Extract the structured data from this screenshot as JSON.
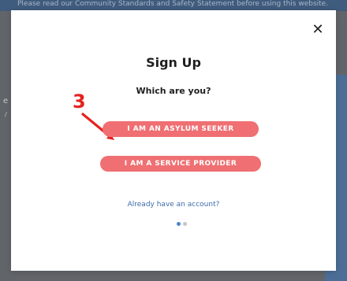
{
  "background": {
    "top_strip_text": "Please read our Community Standards and Safety Statement before using this website.",
    "left_fragment_1": "e",
    "left_fragment_2": "/"
  },
  "modal": {
    "close_symbol": "✕",
    "title": "Sign Up",
    "subtitle": "Which are you?",
    "annotation_number": "3",
    "buttons": [
      "I AM AN ASYLUM SEEKER",
      "I AM A SERVICE PROVIDER"
    ],
    "account_link": "Already have an account?"
  },
  "icons": {
    "close": "close-icon",
    "arrow": "red-arrow-icon"
  },
  "colors": {
    "button": "#ef6f72",
    "annotation": "#e5221f",
    "link": "#3f6ca8",
    "active_dot": "#4c86c7",
    "inactive_dot": "#c6c6c6"
  }
}
